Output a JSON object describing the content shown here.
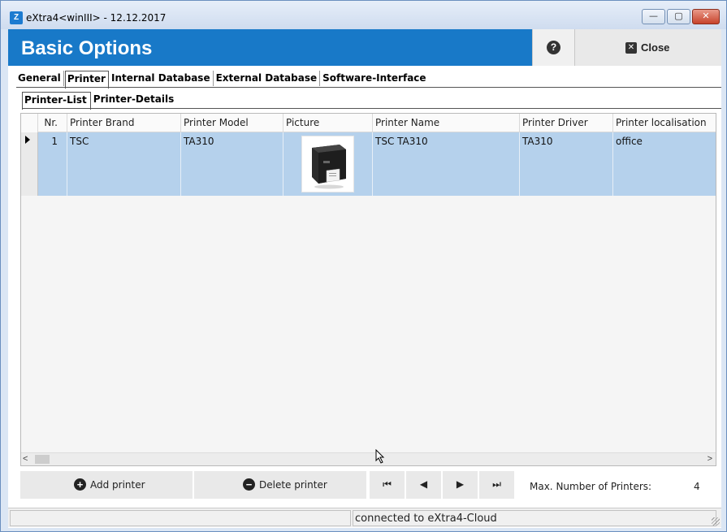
{
  "window": {
    "app_icon": "Z",
    "title": "eXtra4<winIII>  -  12.12.2017",
    "controls": {
      "minimize": "—",
      "maximize": "▢",
      "close": "✕"
    }
  },
  "header": {
    "title": "Basic Options",
    "help_glyph": "?",
    "close_glyph": "✕",
    "close_label": "Close"
  },
  "main_tabs": [
    {
      "label": "General"
    },
    {
      "label": "Printer"
    },
    {
      "label": "Internal Database"
    },
    {
      "label": "External Database"
    },
    {
      "label": "Software-Interface"
    }
  ],
  "sub_tabs": [
    {
      "label": "Printer-List"
    },
    {
      "label": "Printer-Details"
    }
  ],
  "grid": {
    "columns": [
      "Nr.",
      "Printer Brand",
      "Printer Model",
      "Picture",
      "Printer Name",
      "Printer Driver",
      "Printer localisation"
    ],
    "rows": [
      {
        "nr": "1",
        "brand": "TSC",
        "model": "TA310",
        "picture": "printer-image",
        "name": "TSC TA310",
        "driver": "TA310",
        "localisation": "office"
      }
    ],
    "scroll_left": "<",
    "scroll_right": ">"
  },
  "toolbar": {
    "add_icon": "+",
    "add_label": "Add printer",
    "delete_icon": "−",
    "delete_label": "Delete printer",
    "first_glyph": "⏮",
    "prev_glyph": "◀",
    "next_glyph": "▶",
    "last_glyph": "⏭",
    "max_label": "Max. Number of Printers:",
    "max_value": "4"
  },
  "status": {
    "left": "",
    "right": "connected to eXtra4-Cloud"
  },
  "colors": {
    "header_blue": "#1879c8",
    "selected_row": "#b5d1ec"
  }
}
